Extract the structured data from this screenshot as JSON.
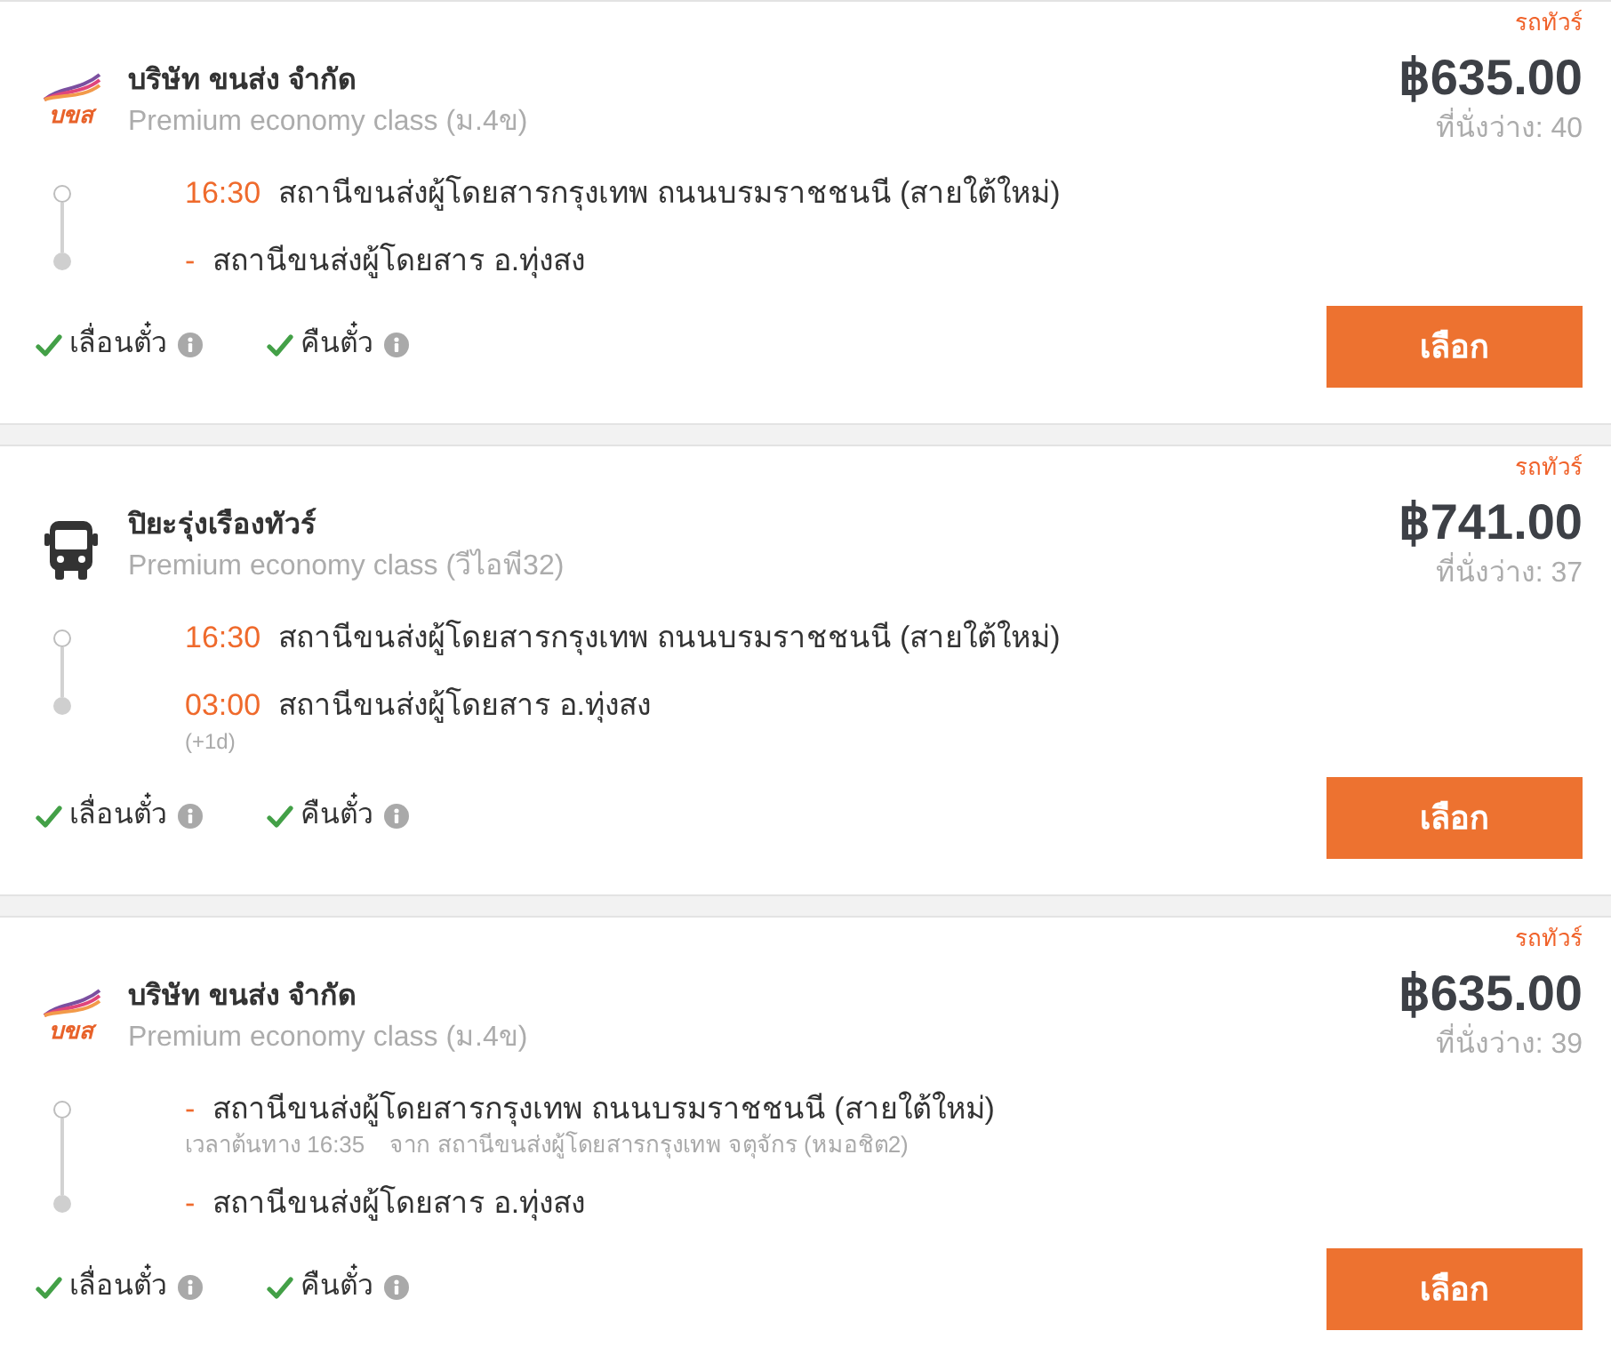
{
  "results": [
    {
      "badge": "รถทัวร์",
      "logo": {
        "kind": "brand",
        "text": "บขส"
      },
      "operator": "บริษัท ขนส่ง จำกัด",
      "bus_class": "Premium economy class (ม.4ข)",
      "price": "฿635.00",
      "seats": "ที่นั่งว่าง: 40",
      "stops": [
        {
          "time": "16:30",
          "station": "สถานีขนส่งผู้โดยสารกรุงเทพ ถนนบรมราชชนนี (สายใต้ใหม่)"
        },
        {
          "time": "-",
          "station": "สถานีขนส่งผู้โดยสาร อ.ทุ่งสง"
        }
      ],
      "features": [
        {
          "label": "เลื่อนตั๋ว",
          "available": true
        },
        {
          "label": "คืนตั๋ว",
          "available": true
        }
      ],
      "button": "เลือก"
    },
    {
      "badge": "รถทัวร์",
      "logo": {
        "kind": "bus"
      },
      "operator": "ปิยะรุ่งเรืองทัวร์",
      "bus_class": "Premium economy class (วีไอพี32)",
      "price": "฿741.00",
      "seats": "ที่นั่งว่าง: 37",
      "stops": [
        {
          "time": "16:30",
          "station": "สถานีขนส่งผู้โดยสารกรุงเทพ ถนนบรมราชชนนี (สายใต้ใหม่)"
        },
        {
          "time": "03:00",
          "station": "สถานีขนส่งผู้โดยสาร อ.ทุ่งสง",
          "day_offset": "(+1d)"
        }
      ],
      "features": [
        {
          "label": "เลื่อนตั๋ว",
          "available": true
        },
        {
          "label": "คืนตั๋ว",
          "available": true
        }
      ],
      "button": "เลือก"
    },
    {
      "badge": "รถทัวร์",
      "logo": {
        "kind": "brand",
        "text": "บขส"
      },
      "operator": "บริษัท ขนส่ง จำกัด",
      "bus_class": "Premium economy class (ม.4ข)",
      "price": "฿635.00",
      "seats": "ที่นั่งว่าง: 39",
      "stops": [
        {
          "time": "-",
          "station": "สถานีขนส่งผู้โดยสารกรุงเทพ ถนนบรมราชชนนี (สายใต้ใหม่)",
          "departure_note": {
            "time": "เวลาต้นทาง 16:35",
            "origin": "จาก สถานีขนส่งผู้โดยสารกรุงเทพ จตุจักร (หมอชิต2)"
          }
        },
        {
          "time": "-",
          "station": "สถานีขนส่งผู้โดยสาร อ.ทุ่งสง"
        }
      ],
      "features": [
        {
          "label": "เลื่อนตั๋ว",
          "available": true
        },
        {
          "label": "คืนตั๋ว",
          "available": true
        }
      ],
      "button": "เลือก"
    }
  ]
}
